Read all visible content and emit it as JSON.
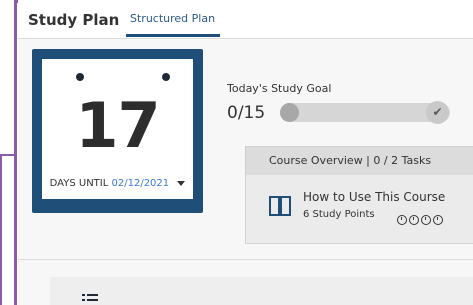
{
  "header": {
    "title": "Study Plan",
    "active_tab": "Structured Plan"
  },
  "calendar": {
    "days": "17",
    "days_until_label": "DAYS UNTIL",
    "date": "02/12/2021"
  },
  "study_goal": {
    "label": "Today's Study Goal",
    "count": "0/15",
    "progress_fraction": 0.0
  },
  "course_overview": {
    "header": "Course Overview | 0 / 2 Tasks",
    "item": {
      "title": "How to Use This Course",
      "points": "6 Study Points",
      "icon": "book-icon"
    }
  },
  "colors": {
    "accent_navy": "#1f4e79",
    "link_blue": "#3a7bd5",
    "frame_purple": "#8e5ba8"
  }
}
